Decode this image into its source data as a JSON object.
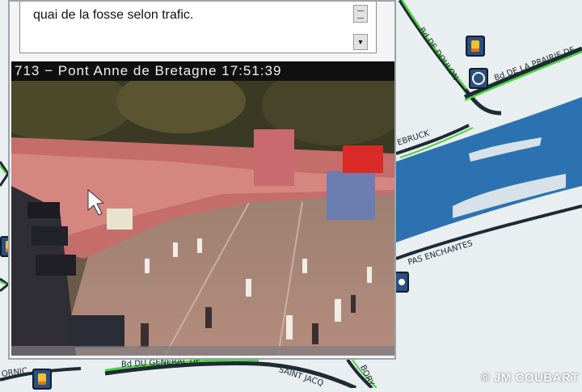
{
  "popup": {
    "message_text": "quai de la fosse selon trafic.",
    "scroll_down_glyph": "▼",
    "camera_title": "713 − Pont Anne de Bretagne 17:51:39"
  },
  "map": {
    "labels": {
      "bd_de_doulon": "Bd DE DOULON",
      "bd_prairie": "Bd DE LA PRAIRIE DE",
      "ebruck": "EBRUCK",
      "pas_enchantes": "PAS ENCHANTES",
      "bd_general": "Bd DU GENERAL DE",
      "saint_jacques": "SAINT JACQ",
      "bory": "BORY",
      "ornic": "ORNIC"
    },
    "icons": [
      "parking-icon",
      "rotation-icon",
      "parking-icon",
      "parking-icon"
    ]
  },
  "watermark": "© JM COUBART",
  "colors": {
    "river": "#2c72b0",
    "traffic_green": "#4cd23a",
    "road_dark": "#1d2b33",
    "map_bg": "#e9eef0"
  }
}
